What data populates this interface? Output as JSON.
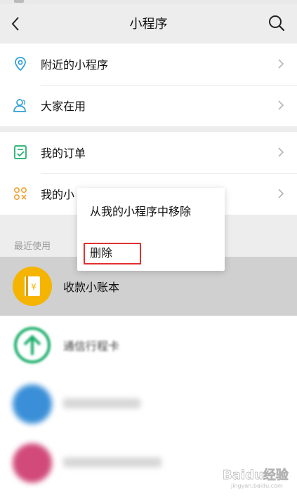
{
  "nav": {
    "title": "小程序",
    "back_icon": "chevron-left-icon",
    "search_icon": "search-icon"
  },
  "menu_group_1": [
    {
      "label": "附近的小程序",
      "icon": "location-pin-icon"
    },
    {
      "label": "大家在用",
      "icon": "people-icon"
    }
  ],
  "menu_group_2": [
    {
      "label": "我的订单",
      "icon": "order-list-icon"
    },
    {
      "label": "我的小",
      "icon": "mini-program-grid-icon"
    }
  ],
  "recent": {
    "section_label": "最近使用",
    "items": [
      {
        "label": "收款小账本",
        "icon": "ledger-app-icon",
        "state": "pressed"
      },
      {
        "label": "通信行程卡",
        "icon": "travel-card-app-icon",
        "state": "blurred"
      },
      {
        "label": "",
        "icon": "blue-app-icon",
        "state": "blurred"
      },
      {
        "label": "",
        "icon": "pink-app-icon",
        "state": "blurred"
      }
    ]
  },
  "context_menu": {
    "items": [
      "从我的小程序中移除",
      "删除"
    ],
    "highlighted_item": "删除"
  },
  "watermark": {
    "brand": "Baidu经验",
    "url": "jingyan.baidu.com"
  },
  "colors": {
    "accent_blue": "#2e9fd8",
    "accent_green": "#1aad6a",
    "accent_orange": "#f0a23a",
    "ledger_yellow": "#f5b400",
    "highlight_red": "#e23030",
    "pressed_bg": "#d0d0d0"
  }
}
